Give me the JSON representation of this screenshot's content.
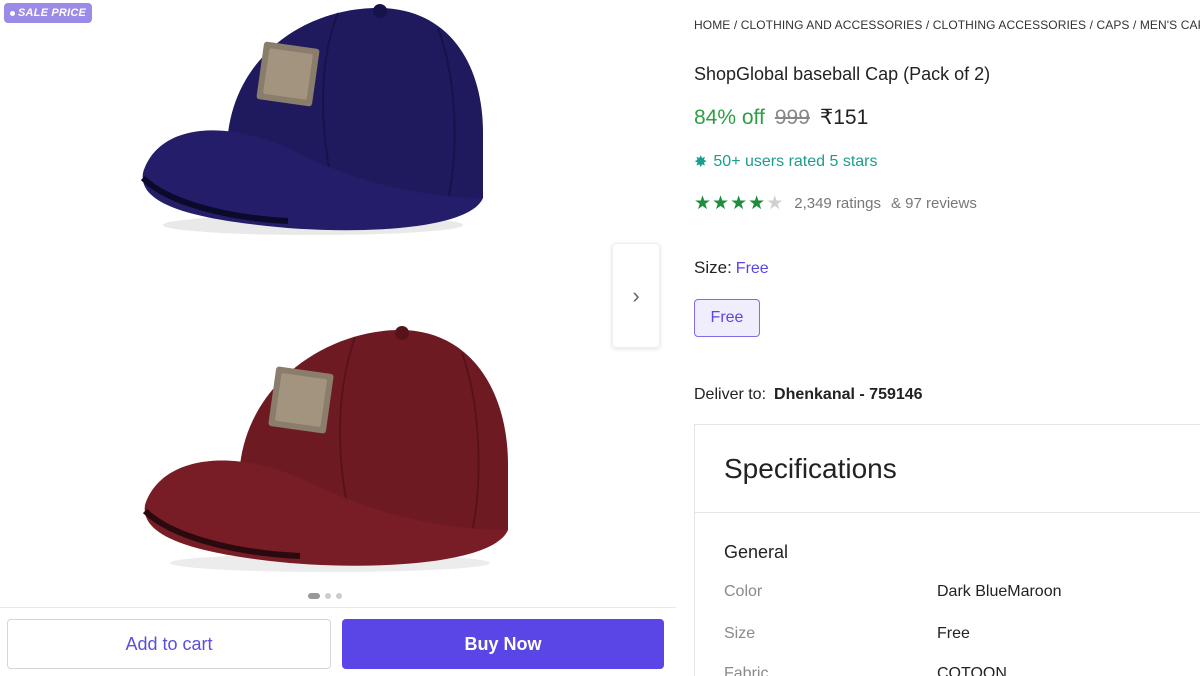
{
  "gallery": {
    "badge": "SALE PRICE",
    "products": [
      {
        "color": "#1f1a5e",
        "name": "navy-cap"
      },
      {
        "color": "#6e1a22",
        "name": "maroon-cap"
      }
    ],
    "next_icon": "chevron-right-icon",
    "pagination_count": 3,
    "pagination_active": 1
  },
  "actions": {
    "add_to_cart": "Add to cart",
    "buy_now": "Buy Now"
  },
  "product": {
    "breadcrumb": "HOME / CLOTHING AND ACCESSORIES / CLOTHING ACCESSORIES / CAPS / MEN'S CAPS",
    "title": "ShopGlobal baseball Cap (Pack of 2)",
    "discount": "84% off",
    "mrp": "999",
    "price": "₹151",
    "users_rated": "50+ users rated 5 stars",
    "stars": 4,
    "stars_max": 5,
    "ratings_count": "2,349 ratings",
    "reviews_count": "& 97 reviews",
    "size_label": "Size:",
    "size_value": "Free",
    "size_option": "Free",
    "deliver_label": "Deliver to:",
    "deliver_location": "Dhenkanal - 759146"
  },
  "specifications": {
    "heading": "Specifications",
    "group": "General",
    "rows": [
      {
        "key": "Color",
        "value": "Dark BlueMaroon"
      },
      {
        "key": "Size",
        "value": "Free"
      },
      {
        "key": "Fabric",
        "value": "COTOON"
      }
    ]
  },
  "colors": {
    "accent": "#5a45e6",
    "discount": "#2e9e44",
    "rated": "#1c9d8c",
    "star": "#1e8e3e"
  }
}
